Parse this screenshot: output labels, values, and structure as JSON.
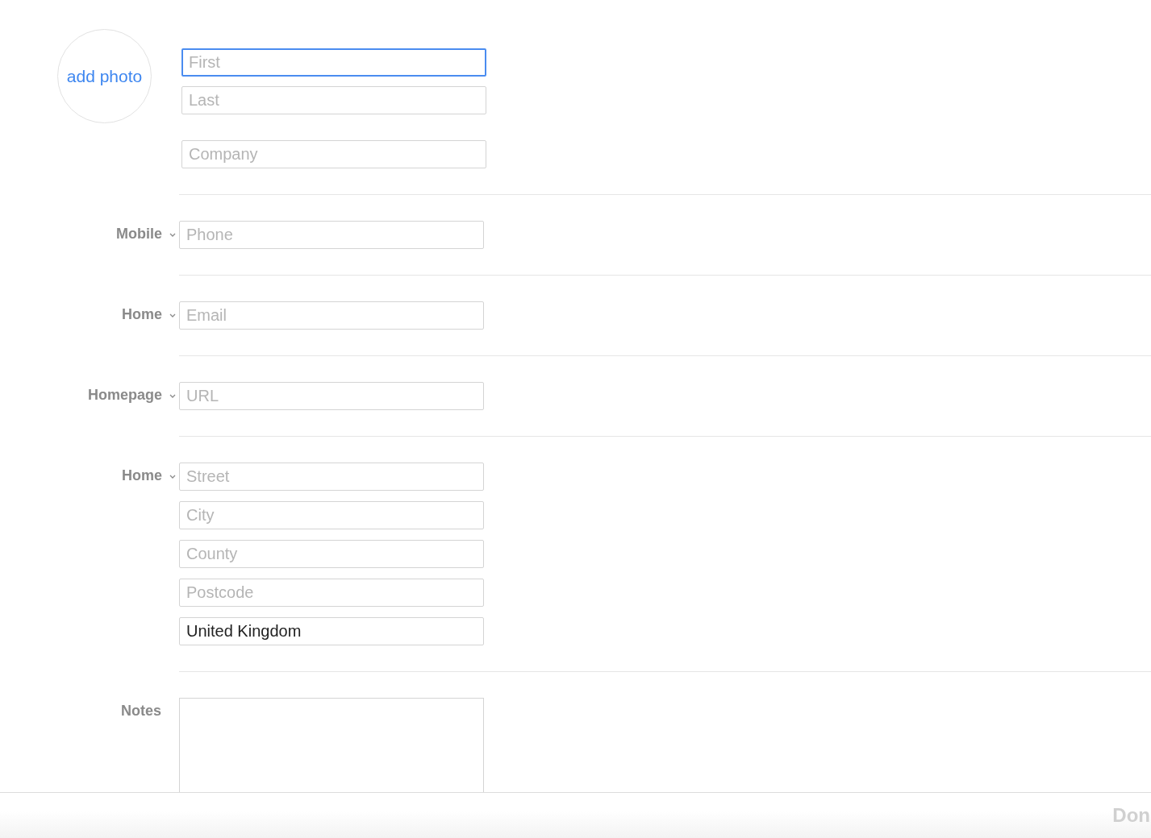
{
  "photo_button": {
    "label": "add photo"
  },
  "name_fields": [
    {
      "placeholder": "First",
      "focused": true
    },
    {
      "placeholder": "Last",
      "focused": false
    }
  ],
  "company_field": {
    "placeholder": "Company",
    "focused": false
  },
  "sections": [
    {
      "kind": "fields",
      "label": "Mobile",
      "dropdown": true,
      "fields": [
        {
          "placeholder": "Phone"
        }
      ]
    },
    {
      "kind": "fields",
      "label": "Home",
      "dropdown": true,
      "fields": [
        {
          "placeholder": "Email"
        }
      ]
    },
    {
      "kind": "fields",
      "label": "Homepage",
      "dropdown": true,
      "fields": [
        {
          "placeholder": "URL"
        }
      ]
    },
    {
      "kind": "fields",
      "label": "Home",
      "dropdown": true,
      "fields": [
        {
          "placeholder": "Street"
        },
        {
          "placeholder": "City"
        },
        {
          "placeholder": "County"
        },
        {
          "placeholder": "Postcode"
        },
        {
          "value": "United Kingdom"
        }
      ]
    },
    {
      "kind": "textarea",
      "label": "Notes",
      "dropdown": false
    }
  ],
  "footer": {
    "done_button": "Don"
  }
}
